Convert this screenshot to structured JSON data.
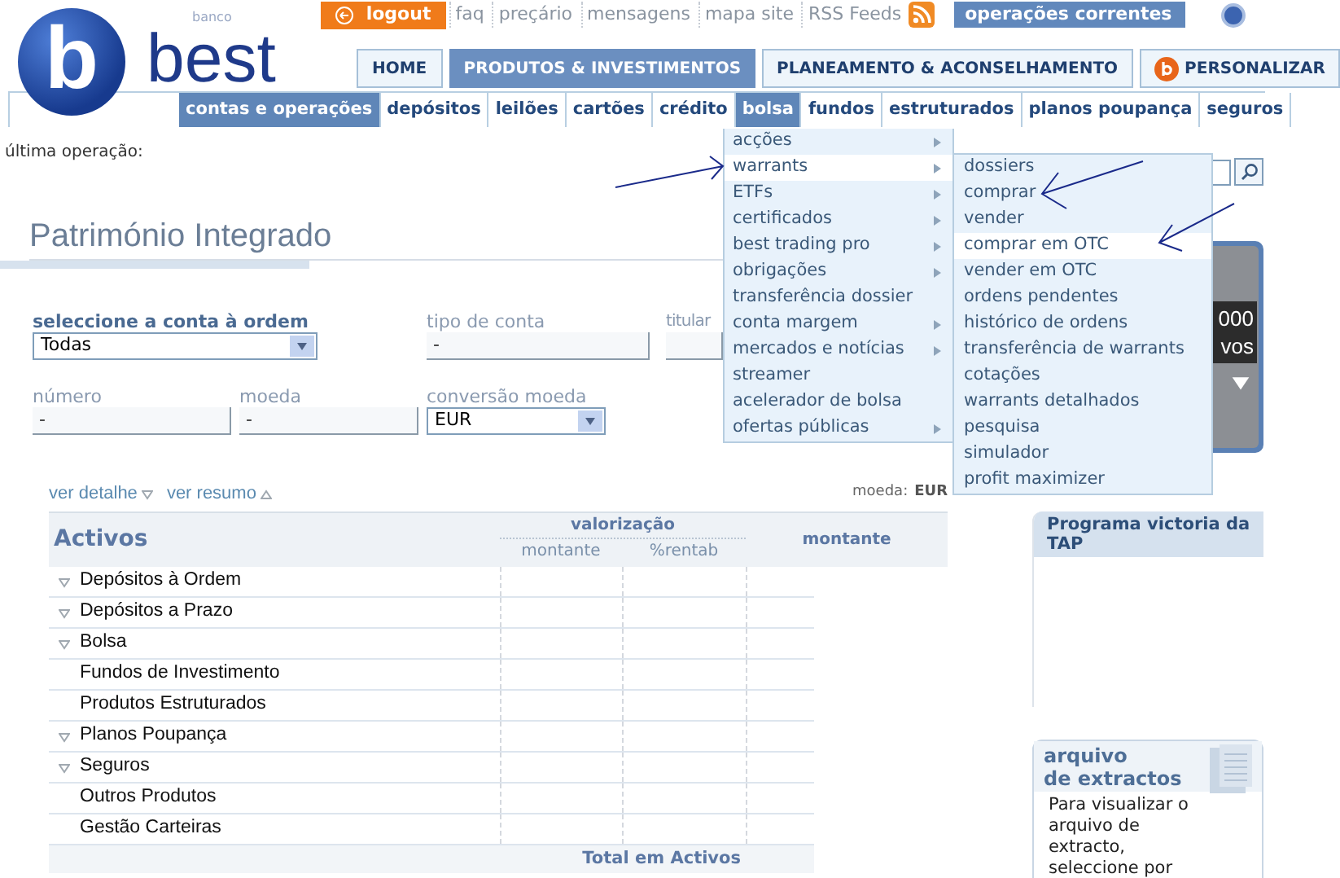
{
  "header": {
    "logo": {
      "mark": "b",
      "tagline": "banco",
      "name": "best"
    },
    "logout": "logout",
    "links": [
      "faq",
      "preçário",
      "mensagens",
      "mapa site",
      "RSS Feeds"
    ],
    "current_operations": "operações correntes"
  },
  "main_tabs": [
    {
      "label": "HOME",
      "selected": false,
      "kind": "plain"
    },
    {
      "label": "PRODUTOS & INVESTIMENTOS",
      "selected": true,
      "kind": "plain"
    },
    {
      "label": "PLANEAMENTO & ACONSELHAMENTO",
      "selected": false,
      "kind": "plain"
    },
    {
      "label": "PERSONALIZAR",
      "selected": false,
      "kind": "icon"
    }
  ],
  "sub_tabs": [
    {
      "label": "contas e operações",
      "selected": true
    },
    {
      "label": "depósitos",
      "selected": false
    },
    {
      "label": "leilões",
      "selected": false
    },
    {
      "label": "cartões",
      "selected": false
    },
    {
      "label": "crédito",
      "selected": false
    },
    {
      "label": "bolsa",
      "selected": true
    },
    {
      "label": "fundos",
      "selected": false
    },
    {
      "label": "estruturados",
      "selected": false
    },
    {
      "label": "planos poupança",
      "selected": false
    },
    {
      "label": "seguros",
      "selected": false
    }
  ],
  "last_operation": "última operação:",
  "page_title": "Património Integrado",
  "form": {
    "account": {
      "label": "seleccione a conta à ordem",
      "value": "Todas"
    },
    "account_type": {
      "label": "tipo de conta",
      "value": "-"
    },
    "holders": {
      "label": "titular"
    },
    "number": {
      "label": "número",
      "value": "-"
    },
    "currency": {
      "label": "moeda",
      "value": "-"
    },
    "conversion": {
      "label": "conversão moeda",
      "value": "EUR"
    }
  },
  "table": {
    "links": [
      "ver detalhe",
      "ver resumo"
    ],
    "currency_label": "moeda:",
    "currency": "EUR",
    "title": "Activos",
    "group_header": "valorização",
    "columns": [
      "montante",
      "%rentab",
      "montante"
    ],
    "rows": [
      {
        "label": "Depósitos à Ordem",
        "expandable": true
      },
      {
        "label": "Depósitos a Prazo",
        "expandable": true
      },
      {
        "label": "Bolsa",
        "expandable": true
      },
      {
        "label": "Fundos de Investimento",
        "expandable": false
      },
      {
        "label": "Produtos Estruturados",
        "expandable": false
      },
      {
        "label": "Planos Poupança",
        "expandable": true
      },
      {
        "label": "Seguros",
        "expandable": true
      },
      {
        "label": "Outros Produtos",
        "expandable": false
      },
      {
        "label": "Gestão Carteiras",
        "expandable": false
      }
    ],
    "total": "Total em Activos"
  },
  "menu": {
    "items": [
      {
        "label": "acções",
        "has_submenu": true,
        "selected": false
      },
      {
        "label": "warrants",
        "has_submenu": true,
        "selected": true
      },
      {
        "label": "ETFs",
        "has_submenu": true,
        "selected": false
      },
      {
        "label": "certificados",
        "has_submenu": true,
        "selected": false
      },
      {
        "label": "best trading pro",
        "has_submenu": true,
        "selected": false
      },
      {
        "label": "obrigações",
        "has_submenu": true,
        "selected": false
      },
      {
        "label": "transferência dossier",
        "has_submenu": false,
        "selected": false
      },
      {
        "label": "conta margem",
        "has_submenu": true,
        "selected": false
      },
      {
        "label": "mercados e notícias",
        "has_submenu": true,
        "selected": false
      },
      {
        "label": "streamer",
        "has_submenu": false,
        "selected": false
      },
      {
        "label": "acelerador de bolsa",
        "has_submenu": false,
        "selected": false
      },
      {
        "label": "ofertas públicas",
        "has_submenu": true,
        "selected": false
      }
    ]
  },
  "submenu": {
    "items": [
      {
        "label": "dossiers",
        "selected": false
      },
      {
        "label": "comprar",
        "selected": false
      },
      {
        "label": "vender",
        "selected": false
      },
      {
        "label": "comprar em OTC",
        "selected": true
      },
      {
        "label": "vender em OTC",
        "selected": false
      },
      {
        "label": "ordens pendentes",
        "selected": false
      },
      {
        "label": "histórico de ordens",
        "selected": false
      },
      {
        "label": "transferência de warrants",
        "selected": false
      },
      {
        "label": "cotações",
        "selected": false
      },
      {
        "label": "warrants detalhados",
        "selected": false
      },
      {
        "label": "pesquisa",
        "selected": false
      },
      {
        "label": "simulador",
        "selected": false
      },
      {
        "label": "profit maximizer",
        "selected": false
      }
    ]
  },
  "sidebar": {
    "banner": {
      "lines": [
        "000",
        "vos"
      ]
    },
    "promo": {
      "title": "Programa victoria da TAP"
    },
    "statements": {
      "title": [
        "arquivo",
        "de extractos"
      ],
      "text": "Para visualizar o arquivo de extracto, seleccione por"
    }
  }
}
